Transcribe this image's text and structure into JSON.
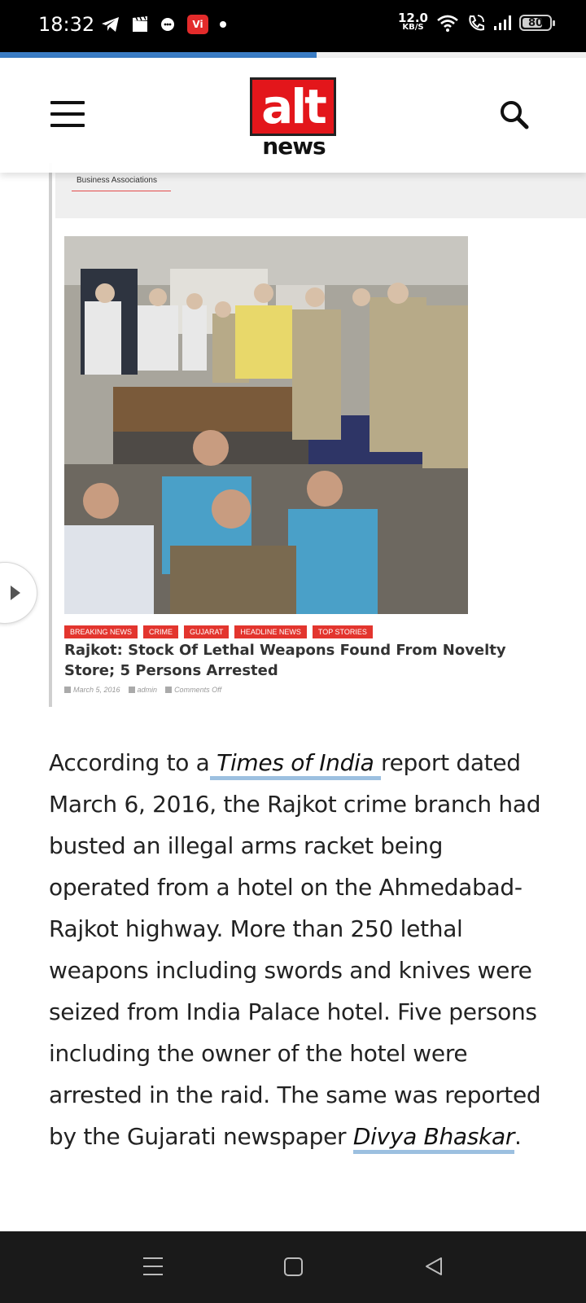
{
  "status_bar": {
    "time": "18:32",
    "vi_label": "Vi",
    "speed_value": "12.0",
    "speed_unit": "KB/S",
    "battery": "80",
    "icons": [
      "telegram-icon",
      "clapperboard-icon",
      "bubble-icon",
      "vi-icon",
      "dot-icon",
      "wifi-icon",
      "wifi-calling-icon",
      "signal-icon",
      "battery-icon"
    ]
  },
  "page_loading_progress": 0.54,
  "header": {
    "logo_top": "alt",
    "logo_bottom": "news",
    "menu_icon": "hamburger-icon",
    "search_icon": "search-icon"
  },
  "embedded_screenshot": {
    "nav_tab": "Business Associations",
    "tags": [
      "BREAKING NEWS",
      "CRIME",
      "GUJARAT",
      "HEADLINE NEWS",
      "TOP STORIES"
    ],
    "title": "Rajkot: Stock Of Lethal Weapons Found From Novelty Store; 5 Persons Arrested",
    "date": "March 5, 2016",
    "author": "admin",
    "comments": "Comments Off"
  },
  "article": {
    "p1_before_link": "According to a",
    "link1": " Times of India ",
    "p1_after_link": "report dated March 6, 2016, the Rajkot crime branch had busted an illegal arms racket being operated from a hotel on the Ahmedabad-Rajkot highway. More than 250 lethal weapons including swords and knives were seized from India Palace hotel. Five persons including the owner of the hotel were arrested in the raid. The same was reported by the Gujarati newspaper ",
    "link2": "Divya Bhaskar",
    "p1_end": "."
  },
  "nav_bar": {
    "icons": [
      "recent-apps-icon",
      "home-icon",
      "back-icon"
    ]
  }
}
